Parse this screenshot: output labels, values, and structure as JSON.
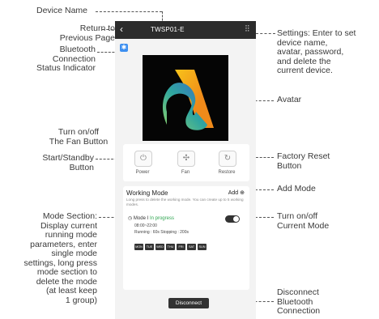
{
  "annotations": {
    "device_name": "Device Name",
    "return": "Return to\nPrevious Page",
    "bluetooth": "Bluetooth\nConnection\nStatus Indicator",
    "fan_button": "Turn on/off\nThe Fan Button",
    "start_standby": "Start/Standby\nButton",
    "mode_section": "Mode Section:\nDisplay current\nrunning mode\nparameters, enter\nsingle mode\nsettings, long press\nmode section to\ndelete the mode\n(at least keep\n1 group)",
    "settings": "Settings: Enter to set\ndevice name,\navatar, password,\nand delete the\ncurrent device.",
    "avatar": "Avatar",
    "factory_reset": "Factory Reset\nButton",
    "add_mode": "Add Mode",
    "turn_current_mode": "Turn on/off\nCurrent Mode",
    "disconnect": "Disconnect\nBluetooth\nConnection"
  },
  "app": {
    "back_icon": "‹",
    "title": "TWSP01-E",
    "settings_icon": "⫶⫶"
  },
  "controls": {
    "power": "Power",
    "fan": "Fan",
    "restore": "Restore"
  },
  "working_mode": {
    "title": "Working Mode",
    "add_label": "Add",
    "hint": "Long press to delete the working mode. You can create up to 5 working modes.",
    "mode_name": "Mode I",
    "mode_status": "In progress",
    "time_range": "08:00~22:00",
    "running_text": "Running : 60s Stopping : 200s",
    "days": [
      "MON",
      "TUE",
      "WED",
      "THU",
      "FRI",
      "SAT",
      "SUN"
    ]
  },
  "disconnect_label": "Disconnect"
}
